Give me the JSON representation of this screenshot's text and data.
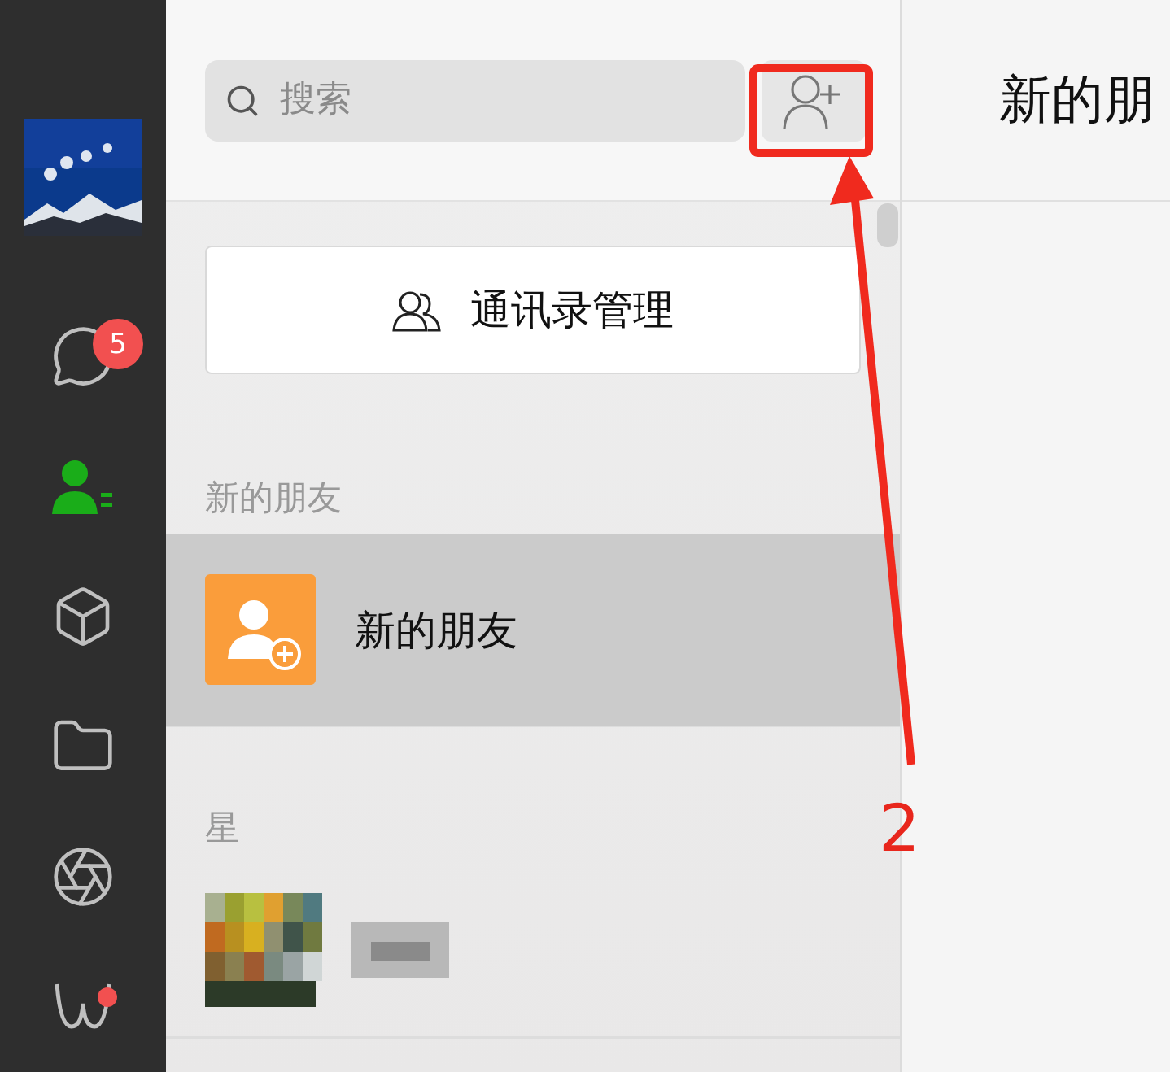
{
  "sidebar": {
    "items": [
      {
        "kind": "avatar"
      },
      {
        "kind": "chat",
        "badge": "5",
        "selected": false
      },
      {
        "kind": "contacts",
        "selected": true
      },
      {
        "kind": "cube",
        "selected": false
      },
      {
        "kind": "folder",
        "selected": false
      },
      {
        "kind": "aperture",
        "selected": false
      },
      {
        "kind": "mini",
        "notified": true,
        "selected": false
      }
    ]
  },
  "search": {
    "placeholder": "搜索"
  },
  "manage_button": {
    "label": "通讯录管理"
  },
  "contacts": [
    {
      "kind": "section",
      "label": "新的朋友"
    },
    {
      "kind": "contact",
      "name": "新的朋友",
      "selected": true
    },
    {
      "kind": "section",
      "label": "星"
    },
    {
      "kind": "hidden",
      "selected": false
    }
  ],
  "detail": {
    "title": "新的朋"
  },
  "annotation": {
    "label": "2"
  }
}
